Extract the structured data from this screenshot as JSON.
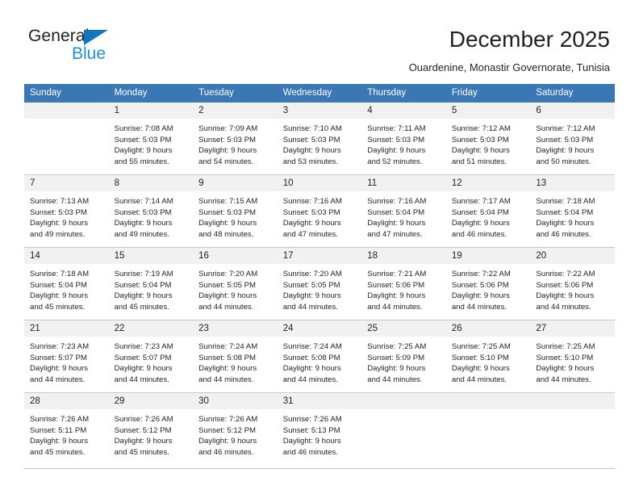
{
  "brand": {
    "name_part1": "General",
    "name_part2": "Blue",
    "triangle_color": "#1175c0",
    "blue_text_color": "#1d8fe0"
  },
  "header": {
    "title": "December 2025",
    "subtitle": "Ouardenine, Monastir Governorate, Tunisia",
    "header_bg_color": "#3a77b5",
    "daynum_bg_color": "#f1f1f1"
  },
  "weekday_headers": [
    "Sunday",
    "Monday",
    "Tuesday",
    "Wednesday",
    "Thursday",
    "Friday",
    "Saturday"
  ],
  "weeks": [
    [
      {
        "day": "",
        "empty": true,
        "sunrise": "",
        "sunset": "",
        "daylight_line1": "",
        "daylight_line2": ""
      },
      {
        "day": "1",
        "empty": false,
        "sunrise": "Sunrise: 7:08 AM",
        "sunset": "Sunset: 5:03 PM",
        "daylight_line1": "Daylight: 9 hours",
        "daylight_line2": "and 55 minutes."
      },
      {
        "day": "2",
        "empty": false,
        "sunrise": "Sunrise: 7:09 AM",
        "sunset": "Sunset: 5:03 PM",
        "daylight_line1": "Daylight: 9 hours",
        "daylight_line2": "and 54 minutes."
      },
      {
        "day": "3",
        "empty": false,
        "sunrise": "Sunrise: 7:10 AM",
        "sunset": "Sunset: 5:03 PM",
        "daylight_line1": "Daylight: 9 hours",
        "daylight_line2": "and 53 minutes."
      },
      {
        "day": "4",
        "empty": false,
        "sunrise": "Sunrise: 7:11 AM",
        "sunset": "Sunset: 5:03 PM",
        "daylight_line1": "Daylight: 9 hours",
        "daylight_line2": "and 52 minutes."
      },
      {
        "day": "5",
        "empty": false,
        "sunrise": "Sunrise: 7:12 AM",
        "sunset": "Sunset: 5:03 PM",
        "daylight_line1": "Daylight: 9 hours",
        "daylight_line2": "and 51 minutes."
      },
      {
        "day": "6",
        "empty": false,
        "sunrise": "Sunrise: 7:12 AM",
        "sunset": "Sunset: 5:03 PM",
        "daylight_line1": "Daylight: 9 hours",
        "daylight_line2": "and 50 minutes."
      }
    ],
    [
      {
        "day": "7",
        "empty": false,
        "sunrise": "Sunrise: 7:13 AM",
        "sunset": "Sunset: 5:03 PM",
        "daylight_line1": "Daylight: 9 hours",
        "daylight_line2": "and 49 minutes."
      },
      {
        "day": "8",
        "empty": false,
        "sunrise": "Sunrise: 7:14 AM",
        "sunset": "Sunset: 5:03 PM",
        "daylight_line1": "Daylight: 9 hours",
        "daylight_line2": "and 49 minutes."
      },
      {
        "day": "9",
        "empty": false,
        "sunrise": "Sunrise: 7:15 AM",
        "sunset": "Sunset: 5:03 PM",
        "daylight_line1": "Daylight: 9 hours",
        "daylight_line2": "and 48 minutes."
      },
      {
        "day": "10",
        "empty": false,
        "sunrise": "Sunrise: 7:16 AM",
        "sunset": "Sunset: 5:03 PM",
        "daylight_line1": "Daylight: 9 hours",
        "daylight_line2": "and 47 minutes."
      },
      {
        "day": "11",
        "empty": false,
        "sunrise": "Sunrise: 7:16 AM",
        "sunset": "Sunset: 5:04 PM",
        "daylight_line1": "Daylight: 9 hours",
        "daylight_line2": "and 47 minutes."
      },
      {
        "day": "12",
        "empty": false,
        "sunrise": "Sunrise: 7:17 AM",
        "sunset": "Sunset: 5:04 PM",
        "daylight_line1": "Daylight: 9 hours",
        "daylight_line2": "and 46 minutes."
      },
      {
        "day": "13",
        "empty": false,
        "sunrise": "Sunrise: 7:18 AM",
        "sunset": "Sunset: 5:04 PM",
        "daylight_line1": "Daylight: 9 hours",
        "daylight_line2": "and 46 minutes."
      }
    ],
    [
      {
        "day": "14",
        "empty": false,
        "sunrise": "Sunrise: 7:18 AM",
        "sunset": "Sunset: 5:04 PM",
        "daylight_line1": "Daylight: 9 hours",
        "daylight_line2": "and 45 minutes."
      },
      {
        "day": "15",
        "empty": false,
        "sunrise": "Sunrise: 7:19 AM",
        "sunset": "Sunset: 5:04 PM",
        "daylight_line1": "Daylight: 9 hours",
        "daylight_line2": "and 45 minutes."
      },
      {
        "day": "16",
        "empty": false,
        "sunrise": "Sunrise: 7:20 AM",
        "sunset": "Sunset: 5:05 PM",
        "daylight_line1": "Daylight: 9 hours",
        "daylight_line2": "and 44 minutes."
      },
      {
        "day": "17",
        "empty": false,
        "sunrise": "Sunrise: 7:20 AM",
        "sunset": "Sunset: 5:05 PM",
        "daylight_line1": "Daylight: 9 hours",
        "daylight_line2": "and 44 minutes."
      },
      {
        "day": "18",
        "empty": false,
        "sunrise": "Sunrise: 7:21 AM",
        "sunset": "Sunset: 5:06 PM",
        "daylight_line1": "Daylight: 9 hours",
        "daylight_line2": "and 44 minutes."
      },
      {
        "day": "19",
        "empty": false,
        "sunrise": "Sunrise: 7:22 AM",
        "sunset": "Sunset: 5:06 PM",
        "daylight_line1": "Daylight: 9 hours",
        "daylight_line2": "and 44 minutes."
      },
      {
        "day": "20",
        "empty": false,
        "sunrise": "Sunrise: 7:22 AM",
        "sunset": "Sunset: 5:06 PM",
        "daylight_line1": "Daylight: 9 hours",
        "daylight_line2": "and 44 minutes."
      }
    ],
    [
      {
        "day": "21",
        "empty": false,
        "sunrise": "Sunrise: 7:23 AM",
        "sunset": "Sunset: 5:07 PM",
        "daylight_line1": "Daylight: 9 hours",
        "daylight_line2": "and 44 minutes."
      },
      {
        "day": "22",
        "empty": false,
        "sunrise": "Sunrise: 7:23 AM",
        "sunset": "Sunset: 5:07 PM",
        "daylight_line1": "Daylight: 9 hours",
        "daylight_line2": "and 44 minutes."
      },
      {
        "day": "23",
        "empty": false,
        "sunrise": "Sunrise: 7:24 AM",
        "sunset": "Sunset: 5:08 PM",
        "daylight_line1": "Daylight: 9 hours",
        "daylight_line2": "and 44 minutes."
      },
      {
        "day": "24",
        "empty": false,
        "sunrise": "Sunrise: 7:24 AM",
        "sunset": "Sunset: 5:08 PM",
        "daylight_line1": "Daylight: 9 hours",
        "daylight_line2": "and 44 minutes."
      },
      {
        "day": "25",
        "empty": false,
        "sunrise": "Sunrise: 7:25 AM",
        "sunset": "Sunset: 5:09 PM",
        "daylight_line1": "Daylight: 9 hours",
        "daylight_line2": "and 44 minutes."
      },
      {
        "day": "26",
        "empty": false,
        "sunrise": "Sunrise: 7:25 AM",
        "sunset": "Sunset: 5:10 PM",
        "daylight_line1": "Daylight: 9 hours",
        "daylight_line2": "and 44 minutes."
      },
      {
        "day": "27",
        "empty": false,
        "sunrise": "Sunrise: 7:25 AM",
        "sunset": "Sunset: 5:10 PM",
        "daylight_line1": "Daylight: 9 hours",
        "daylight_line2": "and 44 minutes."
      }
    ],
    [
      {
        "day": "28",
        "empty": false,
        "sunrise": "Sunrise: 7:26 AM",
        "sunset": "Sunset: 5:11 PM",
        "daylight_line1": "Daylight: 9 hours",
        "daylight_line2": "and 45 minutes."
      },
      {
        "day": "29",
        "empty": false,
        "sunrise": "Sunrise: 7:26 AM",
        "sunset": "Sunset: 5:12 PM",
        "daylight_line1": "Daylight: 9 hours",
        "daylight_line2": "and 45 minutes."
      },
      {
        "day": "30",
        "empty": false,
        "sunrise": "Sunrise: 7:26 AM",
        "sunset": "Sunset: 5:12 PM",
        "daylight_line1": "Daylight: 9 hours",
        "daylight_line2": "and 46 minutes."
      },
      {
        "day": "31",
        "empty": false,
        "sunrise": "Sunrise: 7:26 AM",
        "sunset": "Sunset: 5:13 PM",
        "daylight_line1": "Daylight: 9 hours",
        "daylight_line2": "and 46 minutes."
      },
      {
        "day": "",
        "empty": true,
        "sunrise": "",
        "sunset": "",
        "daylight_line1": "",
        "daylight_line2": ""
      },
      {
        "day": "",
        "empty": true,
        "sunrise": "",
        "sunset": "",
        "daylight_line1": "",
        "daylight_line2": ""
      },
      {
        "day": "",
        "empty": true,
        "sunrise": "",
        "sunset": "",
        "daylight_line1": "",
        "daylight_line2": ""
      }
    ]
  ]
}
